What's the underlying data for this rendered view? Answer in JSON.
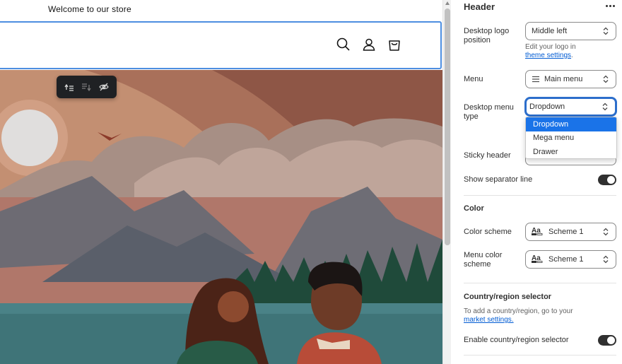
{
  "preview": {
    "announcement": "Welcome to our store",
    "header_icons": [
      "search-icon",
      "account-icon",
      "cart-icon"
    ],
    "toolbar_icons": [
      "move-up-icon",
      "move-down-icon",
      "hide-icon"
    ]
  },
  "panel": {
    "title": "Header",
    "fields": {
      "logo_position": {
        "label_line1": "Desktop logo",
        "label_line2": "position",
        "value": "Middle left"
      },
      "logo_hint": {
        "text": "Edit your logo in",
        "link": "theme settings",
        "suffix": "."
      },
      "menu": {
        "label": "Menu",
        "value": "Main menu"
      },
      "menu_type": {
        "label_line1": "Desktop menu",
        "label_line2": "type",
        "value": "Dropdown"
      },
      "sticky_header": {
        "label": "Sticky header"
      },
      "separator": {
        "label": "Show separator line",
        "on": true
      }
    },
    "color_section": {
      "title": "Color",
      "scheme": {
        "label": "Color scheme",
        "value": "Scheme 1"
      },
      "menu_scheme": {
        "label_line1": "Menu color",
        "label_line2": "scheme",
        "value": "Scheme 1"
      }
    },
    "country_section": {
      "title": "Country/region selector",
      "hint": "To add a country/region, go to your",
      "link": "market settings.",
      "enable": {
        "label": "Enable country/region selector",
        "on": true
      }
    }
  },
  "dropdown": {
    "options": [
      "Dropdown",
      "Mega menu",
      "Drawer"
    ],
    "selected": "Dropdown"
  },
  "colors": {
    "focus": "#2c6ecb",
    "option_highlight": "#1a73e8",
    "link": "#005bd3",
    "header_outline": "#4d8ee0"
  }
}
